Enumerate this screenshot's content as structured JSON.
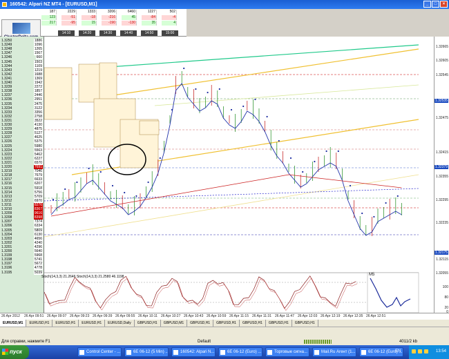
{
  "window": {
    "title": "160542: Alpari NZ MT4 - [EURUSD,M1]"
  },
  "brand": "ClusterDelta.com",
  "tape": {
    "rows": [
      [
        "187",
        "2229",
        "1333",
        "3206",
        "6460",
        "1227",
        "502"
      ],
      [
        "123",
        "-51",
        "-18",
        "-216",
        "45",
        "-84",
        "-4"
      ],
      [
        "217",
        "-95",
        "15",
        "-190",
        "-130",
        "35",
        "4"
      ]
    ],
    "times": [
      "14:10",
      "14:20",
      "14:30",
      "14:40",
      "14:50",
      "15:00"
    ]
  },
  "price_ladder": [
    {
      "price": "1.3250",
      "vol": "1886"
    },
    {
      "price": "1.3249",
      "vol": "1096"
    },
    {
      "price": "1.3248",
      "vol": "1265"
    },
    {
      "price": "1.3247",
      "vol": "1567"
    },
    {
      "price": "1.3246",
      "vol": "660"
    },
    {
      "price": "1.3245",
      "vol": "1503"
    },
    {
      "price": "1.3244",
      "vol": "1109"
    },
    {
      "price": "1.3243",
      "vol": "1219"
    },
    {
      "price": "1.3242",
      "vol": "1688"
    },
    {
      "price": "1.3241",
      "vol": "1369"
    },
    {
      "price": "1.3240",
      "vol": "1942"
    },
    {
      "price": "1.3239",
      "vol": "2272"
    },
    {
      "price": "1.3238",
      "vol": "1857"
    },
    {
      "price": "1.3237",
      "vol": "2446"
    },
    {
      "price": "1.3236",
      "vol": "2951"
    },
    {
      "price": "1.3235",
      "vol": "2475"
    },
    {
      "price": "1.3234",
      "vol": "3122"
    },
    {
      "price": "1.3233",
      "vol": "3356"
    },
    {
      "price": "1.3232",
      "vol": "2758"
    },
    {
      "price": "1.3231",
      "vol": "3522"
    },
    {
      "price": "1.3230",
      "vol": "4130"
    },
    {
      "price": "1.3229",
      "vol": "4875"
    },
    {
      "price": "1.3228",
      "vol": "5127"
    },
    {
      "price": "1.3227",
      "vol": "4625"
    },
    {
      "price": "1.3226",
      "vol": "5375"
    },
    {
      "price": "1.3225",
      "vol": "5980"
    },
    {
      "price": "1.3224",
      "vol": "5563"
    },
    {
      "price": "1.3223",
      "vol": "5462"
    },
    {
      "price": "1.3222",
      "vol": "6227"
    },
    {
      "price": "1.3221",
      "vol": "6570"
    },
    {
      "price": "1.3220",
      "vol": "7691",
      "hl": true
    },
    {
      "price": "1.3219",
      "vol": "7046"
    },
    {
      "price": "1.3218",
      "vol": "7679"
    },
    {
      "price": "1.3217",
      "vol": "6633"
    },
    {
      "price": "1.3216",
      "vol": "6207"
    },
    {
      "price": "1.3215",
      "vol": "5918"
    },
    {
      "price": "1.3214",
      "vol": "5756"
    },
    {
      "price": "1.3213",
      "vol": "5709"
    },
    {
      "price": "1.3212",
      "vol": "6970"
    },
    {
      "price": "1.3211",
      "vol": "8276",
      "hl": true
    },
    {
      "price": "1.3210",
      "vol": "8367",
      "hl": true
    },
    {
      "price": "1.3209",
      "vol": "9616",
      "hl": true
    },
    {
      "price": "1.3208",
      "vol": "8398",
      "hl": true
    },
    {
      "price": "1.3207",
      "vol": "7374"
    },
    {
      "price": "1.3206",
      "vol": "6334"
    },
    {
      "price": "1.3205",
      "vol": "5809"
    },
    {
      "price": "1.3204",
      "vol": "6130"
    },
    {
      "price": "1.3203",
      "vol": "4656"
    },
    {
      "price": "1.3202",
      "vol": "4240"
    },
    {
      "price": "1.3201",
      "vol": "4296"
    },
    {
      "price": "1.3200",
      "vol": "5640"
    },
    {
      "price": "1.3199",
      "vol": "5968"
    },
    {
      "price": "1.3198",
      "vol": "5741"
    },
    {
      "price": "1.3197",
      "vol": "5672"
    },
    {
      "price": "1.3196",
      "vol": "4778"
    },
    {
      "price": "1.3195",
      "vol": "5039"
    }
  ],
  "right_axis": [
    {
      "label": "1.32665"
    },
    {
      "label": "1.32605"
    },
    {
      "label": "1.32545"
    },
    {
      "label": "1.32535",
      "tag": true
    },
    {
      "label": "1.32475"
    },
    {
      "label": "1.32415"
    },
    {
      "label": "1.32379",
      "tag": true
    },
    {
      "label": "1.32355"
    },
    {
      "label": "1.32295"
    },
    {
      "label": "1.32235"
    },
    {
      "label": "1.32175",
      "tag": true
    },
    {
      "label": "1.32115"
    },
    {
      "label": "1.32055"
    },
    {
      "label": "100"
    },
    {
      "label": "80"
    },
    {
      "label": "20"
    },
    {
      "label": "0"
    }
  ],
  "indicator_label": "Stoch(14,3,3) 21.2646  Stoch(14,3,3) 21.2580 46.1198",
  "m5_label": "M5",
  "date_axis": [
    "26 Apr 2012",
    "26 Apr 09:51",
    "26 Apr 09:07",
    "26 Apr 09:23",
    "26 Apr 09:39",
    "26 Apr 09:55",
    "26 Apr 10:11",
    "26 Apr 10:27",
    "26 Apr 10:43",
    "26 Apr 10:59",
    "26 Apr 11:15",
    "26 Apr 11:31",
    "26 Apr 11:47",
    "26 Apr 12:03",
    "26 Apr 12:19",
    "26 Apr 12:35",
    "26 Apr 12:51"
  ],
  "tabs": [
    "EURUSD,M1",
    "EURUSD,H1",
    "EURUSD,H1",
    "EURUSD,H1",
    "EURUSD,Daily",
    "GBPUSD,H1",
    "GBPUSD,M1",
    "GBPUSD,H1",
    "GBPUSD,H1",
    "GBPUSD,H1",
    "GBPUSD,H1",
    "GBPUSD,H1"
  ],
  "active_tab": 0,
  "status": {
    "help": "Для справки, нажмите F1",
    "profile": "Default",
    "kb": "4011/2 kb"
  },
  "taskbar": {
    "start": "пуск",
    "items": [
      "Control Center - ...",
      "6E 06-12 (5 Min) ...",
      "160542: Alpari N...",
      "6E 06-12 (Euro) ...",
      "Торговые сигна...",
      "Mail.Ru Агент (1...",
      "6E 06-12 (Euro) ..."
    ],
    "lang": "EN",
    "clock": "13:54"
  }
}
